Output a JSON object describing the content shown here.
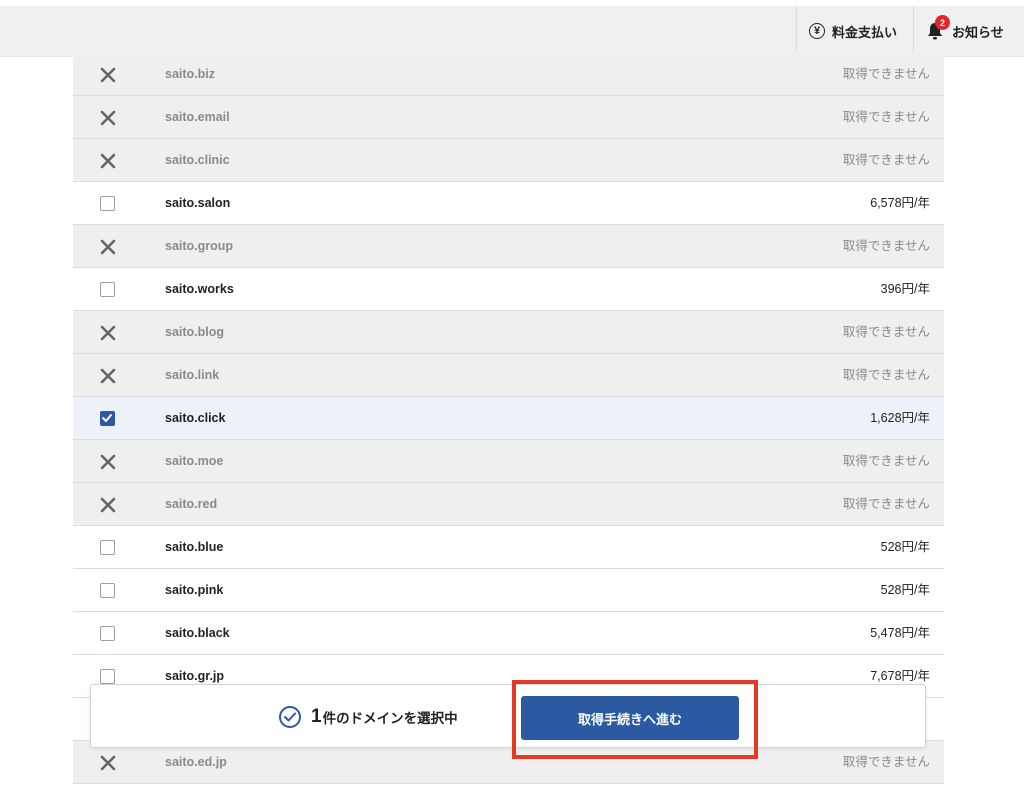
{
  "header": {
    "payment_label": "料金支払い",
    "notice_label": "お知らせ",
    "notice_badge": "2"
  },
  "domains": [
    {
      "name": "saito.biz",
      "price": "取得できません",
      "status": "unavailable"
    },
    {
      "name": "saito.email",
      "price": "取得できません",
      "status": "unavailable"
    },
    {
      "name": "saito.clinic",
      "price": "取得できません",
      "status": "unavailable"
    },
    {
      "name": "saito.salon",
      "price": "6,578円/年",
      "status": "available"
    },
    {
      "name": "saito.group",
      "price": "取得できません",
      "status": "unavailable"
    },
    {
      "name": "saito.works",
      "price": "396円/年",
      "status": "available"
    },
    {
      "name": "saito.blog",
      "price": "取得できません",
      "status": "unavailable"
    },
    {
      "name": "saito.link",
      "price": "取得できません",
      "status": "unavailable"
    },
    {
      "name": "saito.click",
      "price": "1,628円/年",
      "status": "selected"
    },
    {
      "name": "saito.moe",
      "price": "取得できません",
      "status": "unavailable"
    },
    {
      "name": "saito.red",
      "price": "取得できません",
      "status": "unavailable"
    },
    {
      "name": "saito.blue",
      "price": "528円/年",
      "status": "available"
    },
    {
      "name": "saito.pink",
      "price": "528円/年",
      "status": "available"
    },
    {
      "name": "saito.black",
      "price": "5,478円/年",
      "status": "available"
    },
    {
      "name": "saito.gr.jp",
      "price": "7,678円/年",
      "status": "available"
    },
    {
      "name": "",
      "price": "",
      "status": "available"
    },
    {
      "name": "saito.ed.jp",
      "price": "取得できません",
      "status": "unavailable"
    }
  ],
  "selection_bar": {
    "count": "1",
    "text": "件のドメインを選択中",
    "button_label": "取得手続きへ進む"
  },
  "colors": {
    "accent": "#2b5aa3",
    "highlight": "#e33a24",
    "badge": "#e0262a"
  }
}
